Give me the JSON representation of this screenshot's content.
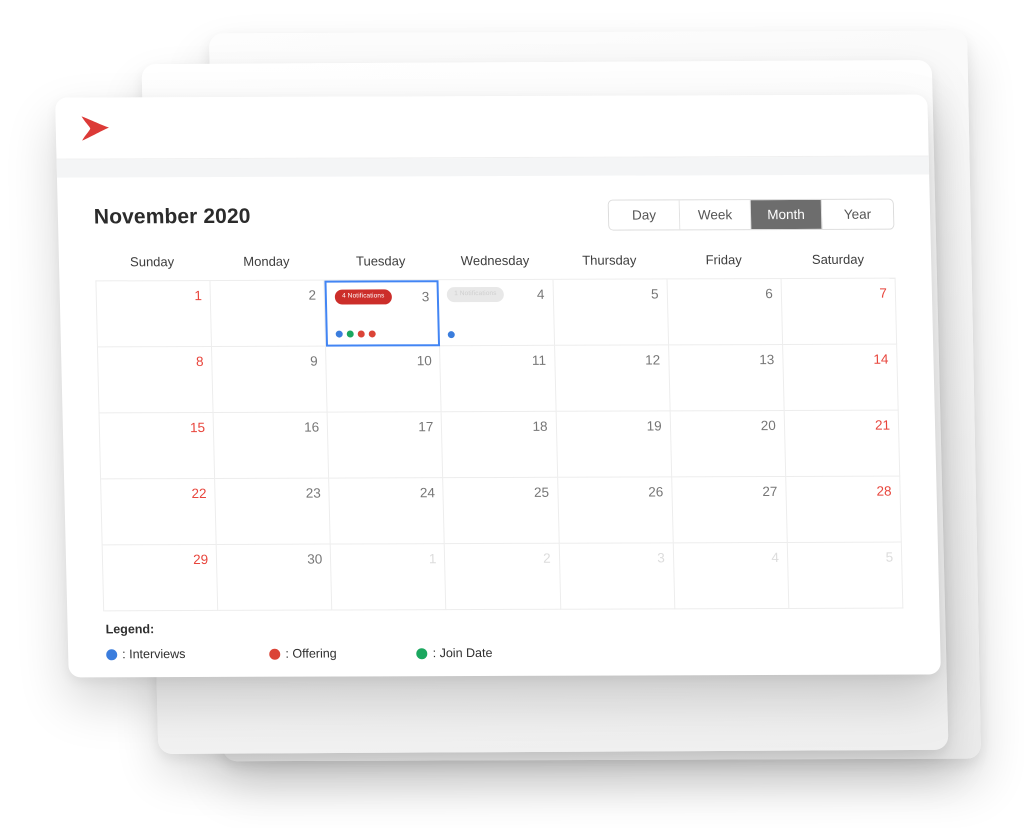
{
  "brand": {
    "logo_icon": "chevron-right-logo",
    "logo_color": "#dc3a37"
  },
  "header": {
    "title": "November 2020"
  },
  "view_toggle": {
    "options": [
      {
        "label": "Day",
        "active": false
      },
      {
        "label": "Week",
        "active": false
      },
      {
        "label": "Month",
        "active": true
      },
      {
        "label": "Year",
        "active": false
      }
    ],
    "selected": "Month"
  },
  "calendar": {
    "weekdays": [
      "Sunday",
      "Monday",
      "Tuesday",
      "Wednesday",
      "Thursday",
      "Friday",
      "Saturday"
    ],
    "weekend_color": "#e8453c",
    "weekday_color": "#767676",
    "other_month_color": "#dcdcdc",
    "selected_border_color": "#4285f4",
    "days": [
      {
        "n": "1",
        "weekend": true,
        "other": false
      },
      {
        "n": "2",
        "weekend": false,
        "other": false
      },
      {
        "n": "3",
        "weekend": false,
        "other": false,
        "selected": true,
        "badge": {
          "text": "4 Notifications",
          "style": "red"
        },
        "dots": [
          "#3b7ddd",
          "#1ba75f",
          "#db4437",
          "#db4437"
        ]
      },
      {
        "n": "4",
        "weekend": false,
        "other": false,
        "badge": {
          "text": "1 Notifications",
          "style": "gray"
        },
        "dots": [
          "#3b7ddd"
        ]
      },
      {
        "n": "5",
        "weekend": false,
        "other": false
      },
      {
        "n": "6",
        "weekend": false,
        "other": false
      },
      {
        "n": "7",
        "weekend": true,
        "other": false
      },
      {
        "n": "8",
        "weekend": true,
        "other": false
      },
      {
        "n": "9",
        "weekend": false,
        "other": false
      },
      {
        "n": "10",
        "weekend": false,
        "other": false
      },
      {
        "n": "11",
        "weekend": false,
        "other": false
      },
      {
        "n": "12",
        "weekend": false,
        "other": false
      },
      {
        "n": "13",
        "weekend": false,
        "other": false
      },
      {
        "n": "14",
        "weekend": true,
        "other": false
      },
      {
        "n": "15",
        "weekend": true,
        "other": false
      },
      {
        "n": "16",
        "weekend": false,
        "other": false
      },
      {
        "n": "17",
        "weekend": false,
        "other": false
      },
      {
        "n": "18",
        "weekend": false,
        "other": false
      },
      {
        "n": "19",
        "weekend": false,
        "other": false
      },
      {
        "n": "20",
        "weekend": false,
        "other": false
      },
      {
        "n": "21",
        "weekend": true,
        "other": false
      },
      {
        "n": "22",
        "weekend": true,
        "other": false
      },
      {
        "n": "23",
        "weekend": false,
        "other": false
      },
      {
        "n": "24",
        "weekend": false,
        "other": false
      },
      {
        "n": "25",
        "weekend": false,
        "other": false
      },
      {
        "n": "26",
        "weekend": false,
        "other": false
      },
      {
        "n": "27",
        "weekend": false,
        "other": false
      },
      {
        "n": "28",
        "weekend": true,
        "other": false
      },
      {
        "n": "29",
        "weekend": true,
        "other": false
      },
      {
        "n": "30",
        "weekend": false,
        "other": false
      },
      {
        "n": "1",
        "weekend": false,
        "other": true
      },
      {
        "n": "2",
        "weekend": false,
        "other": true
      },
      {
        "n": "3",
        "weekend": false,
        "other": true
      },
      {
        "n": "4",
        "weekend": false,
        "other": true
      },
      {
        "n": "5",
        "weekend": false,
        "other": true
      }
    ]
  },
  "legend": {
    "title": "Legend:",
    "items": [
      {
        "label": ": Interviews",
        "color": "#3b7ddd"
      },
      {
        "label": ": Offering",
        "color": "#db4437"
      },
      {
        "label": ": Join Date",
        "color": "#1ba75f"
      }
    ]
  }
}
